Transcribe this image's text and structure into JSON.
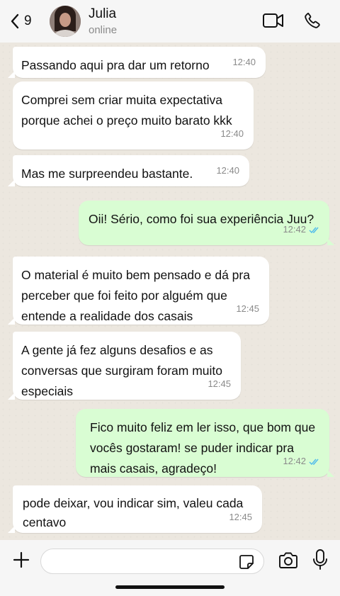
{
  "header": {
    "back_count": "9",
    "contact_name": "Julia",
    "status": "online",
    "icons": [
      "chevron-left-icon",
      "video-call-icon",
      "phone-icon"
    ]
  },
  "messages": [
    {
      "direction": "in",
      "text": "Passando aqui pra dar um retorno",
      "time": "12:40"
    },
    {
      "direction": "in",
      "lines": [
        "Comprei sem criar muita expectativa",
        "porque achei o preço muito barato kkk"
      ],
      "time": "12:40"
    },
    {
      "direction": "in",
      "text": "Mas me surpreendeu bastante.",
      "time": "12:40"
    },
    {
      "direction": "out",
      "text": "Oii! Sério, como foi sua experiência Juu?",
      "time": "12:42",
      "status": "read"
    },
    {
      "direction": "in",
      "lines": [
        "O material é muito bem pensado e dá pra",
        "perceber que foi feito por alguém que",
        "entende a realidade dos casais"
      ],
      "time": "12:45"
    },
    {
      "direction": "in",
      "lines": [
        "A gente já fez alguns desafios e as",
        "conversas que surgiram foram muito",
        "especiais"
      ],
      "time": "12:45"
    },
    {
      "direction": "out",
      "lines": [
        "Fico muito feliz em ler isso, que bom que",
        "vocês gostaram! se puder indicar pra",
        "mais casais, agradeço!"
      ],
      "time": "12:42",
      "status": "read"
    },
    {
      "direction": "in",
      "lines": [
        "pode deixar, vou indicar sim, valeu cada",
        "centavo"
      ],
      "time": "12:45"
    }
  ],
  "input": {
    "placeholder": "",
    "icons": [
      "plus-icon",
      "sticker-icon",
      "camera-icon",
      "microphone-icon"
    ]
  },
  "colors": {
    "outgoing_bubble": "#d9fdd3",
    "incoming_bubble": "#ffffff",
    "read_ticks": "#53bdeb",
    "chat_background": "#ece7df"
  }
}
